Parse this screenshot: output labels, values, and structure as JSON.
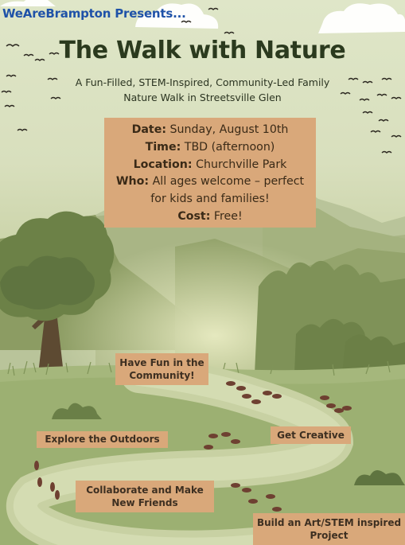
{
  "brand": "WeAreBrampton Presents...",
  "title": "The Walk with Nature",
  "subtitle_lines": [
    "A Fun-Filled, STEM-Inspired, Community-Led Family",
    "Nature Walk in Streetsville Glen"
  ],
  "event": {
    "date_label": "Date:",
    "date_value": "Sunday, August 10th",
    "time_label": "Time:",
    "time_value": "TBD (afternoon)",
    "location_label": "Location:",
    "location_value": "Churchville Park",
    "who_label": "Who:",
    "who_value_line1": "All ages welcome – perfect",
    "who_value_line2": "for kids and families!",
    "cost_label": "Cost:",
    "cost_value": "Free!"
  },
  "trail_signs": {
    "have_fun": [
      "Have Fun in the",
      "Community!"
    ],
    "explore": "Explore the Outdoors",
    "get_creative": "Get Creative",
    "collaborate": [
      "Collaborate and Make",
      "New Friends"
    ],
    "build": [
      "Build an Art/STEM inspired",
      "Project"
    ]
  },
  "colors": {
    "brand_blue": "#1f52a8",
    "sign_tan": "#d9a87a",
    "title_dark_green": "#2b3a1e",
    "footprint_brown": "#6e4031"
  },
  "decorations": {
    "clouds": "cloud-icon",
    "birds": "bird-icon",
    "footprints": "footprint-icon",
    "tree": "tree-icon",
    "mountains": "mountain-icon",
    "bushes": "bush-icon"
  }
}
